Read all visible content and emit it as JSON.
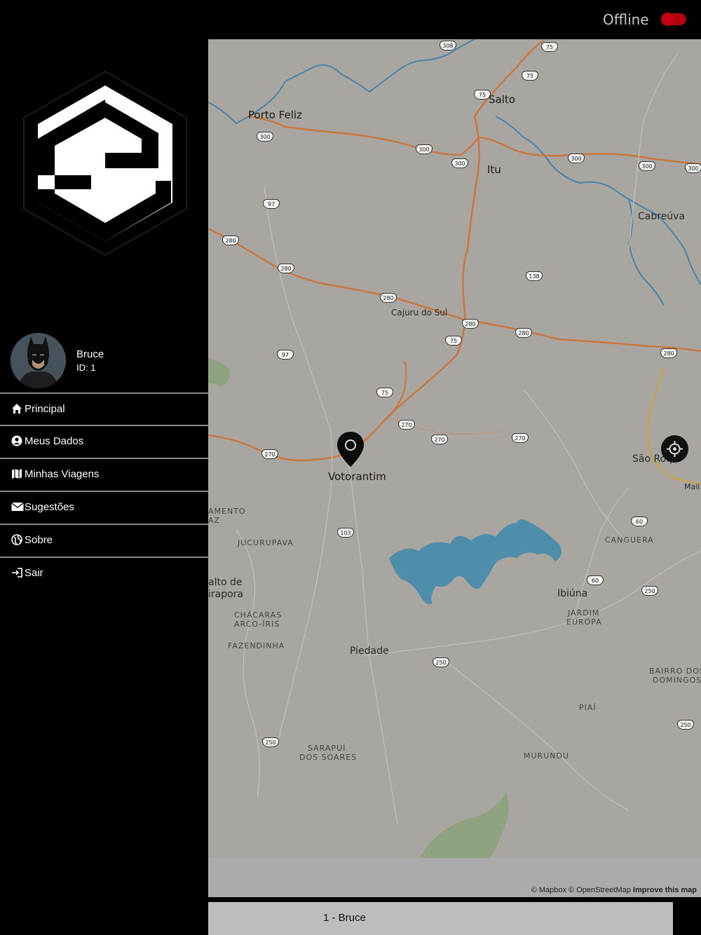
{
  "header": {
    "status_label": "Offline",
    "toggle_state": "off",
    "toggle_color": "#b3000c"
  },
  "user": {
    "name": "Bruce",
    "id_label": "ID: 1",
    "avatar": "batman-avatar"
  },
  "menu": {
    "items": [
      {
        "label": "Principal",
        "icon": "home-icon"
      },
      {
        "label": "Meus Dados",
        "icon": "user-circle-icon"
      },
      {
        "label": "Minhas Viagens",
        "icon": "map-icon"
      },
      {
        "label": "Sugestões",
        "icon": "envelope-icon"
      },
      {
        "label": "Sobre",
        "icon": "globe-icon"
      },
      {
        "label": "Sair",
        "icon": "sign-in-icon"
      }
    ]
  },
  "map": {
    "places": [
      "Porto Feliz",
      "Salto",
      "Itu",
      "Cabreúva",
      "Cajuru do Sul",
      "Votorantim",
      "São Roq",
      "Mail",
      "AMENTO",
      "AZ",
      "JUCURUPAVA",
      "alto de",
      "irapora",
      "CHÁCARAS",
      "ARCO-ÍRIS",
      "FAZENDINHA",
      "Piedade",
      "Ibiúna",
      "CANGUERA",
      "JARDIM",
      "EUROPA",
      "BAIRRO DOS",
      "DOMINGOS",
      "PIAÍ",
      "SARAPUÍ",
      "DOS SOARES",
      "MURUNDU"
    ],
    "road_shields": [
      "308",
      "75",
      "75",
      "75",
      "300",
      "300",
      "300",
      "300",
      "300",
      "300",
      "97",
      "280",
      "280",
      "280",
      "138",
      "280",
      "280",
      "280",
      "75",
      "97",
      "75",
      "270",
      "270",
      "270",
      "270",
      "103",
      "60",
      "60",
      "250",
      "250",
      "250",
      "250"
    ],
    "attribution_left": "© Mapbox © OpenStreetMap",
    "attribution_link": "Improve this map"
  },
  "driver_bar": {
    "label": "1 - Bruce"
  }
}
